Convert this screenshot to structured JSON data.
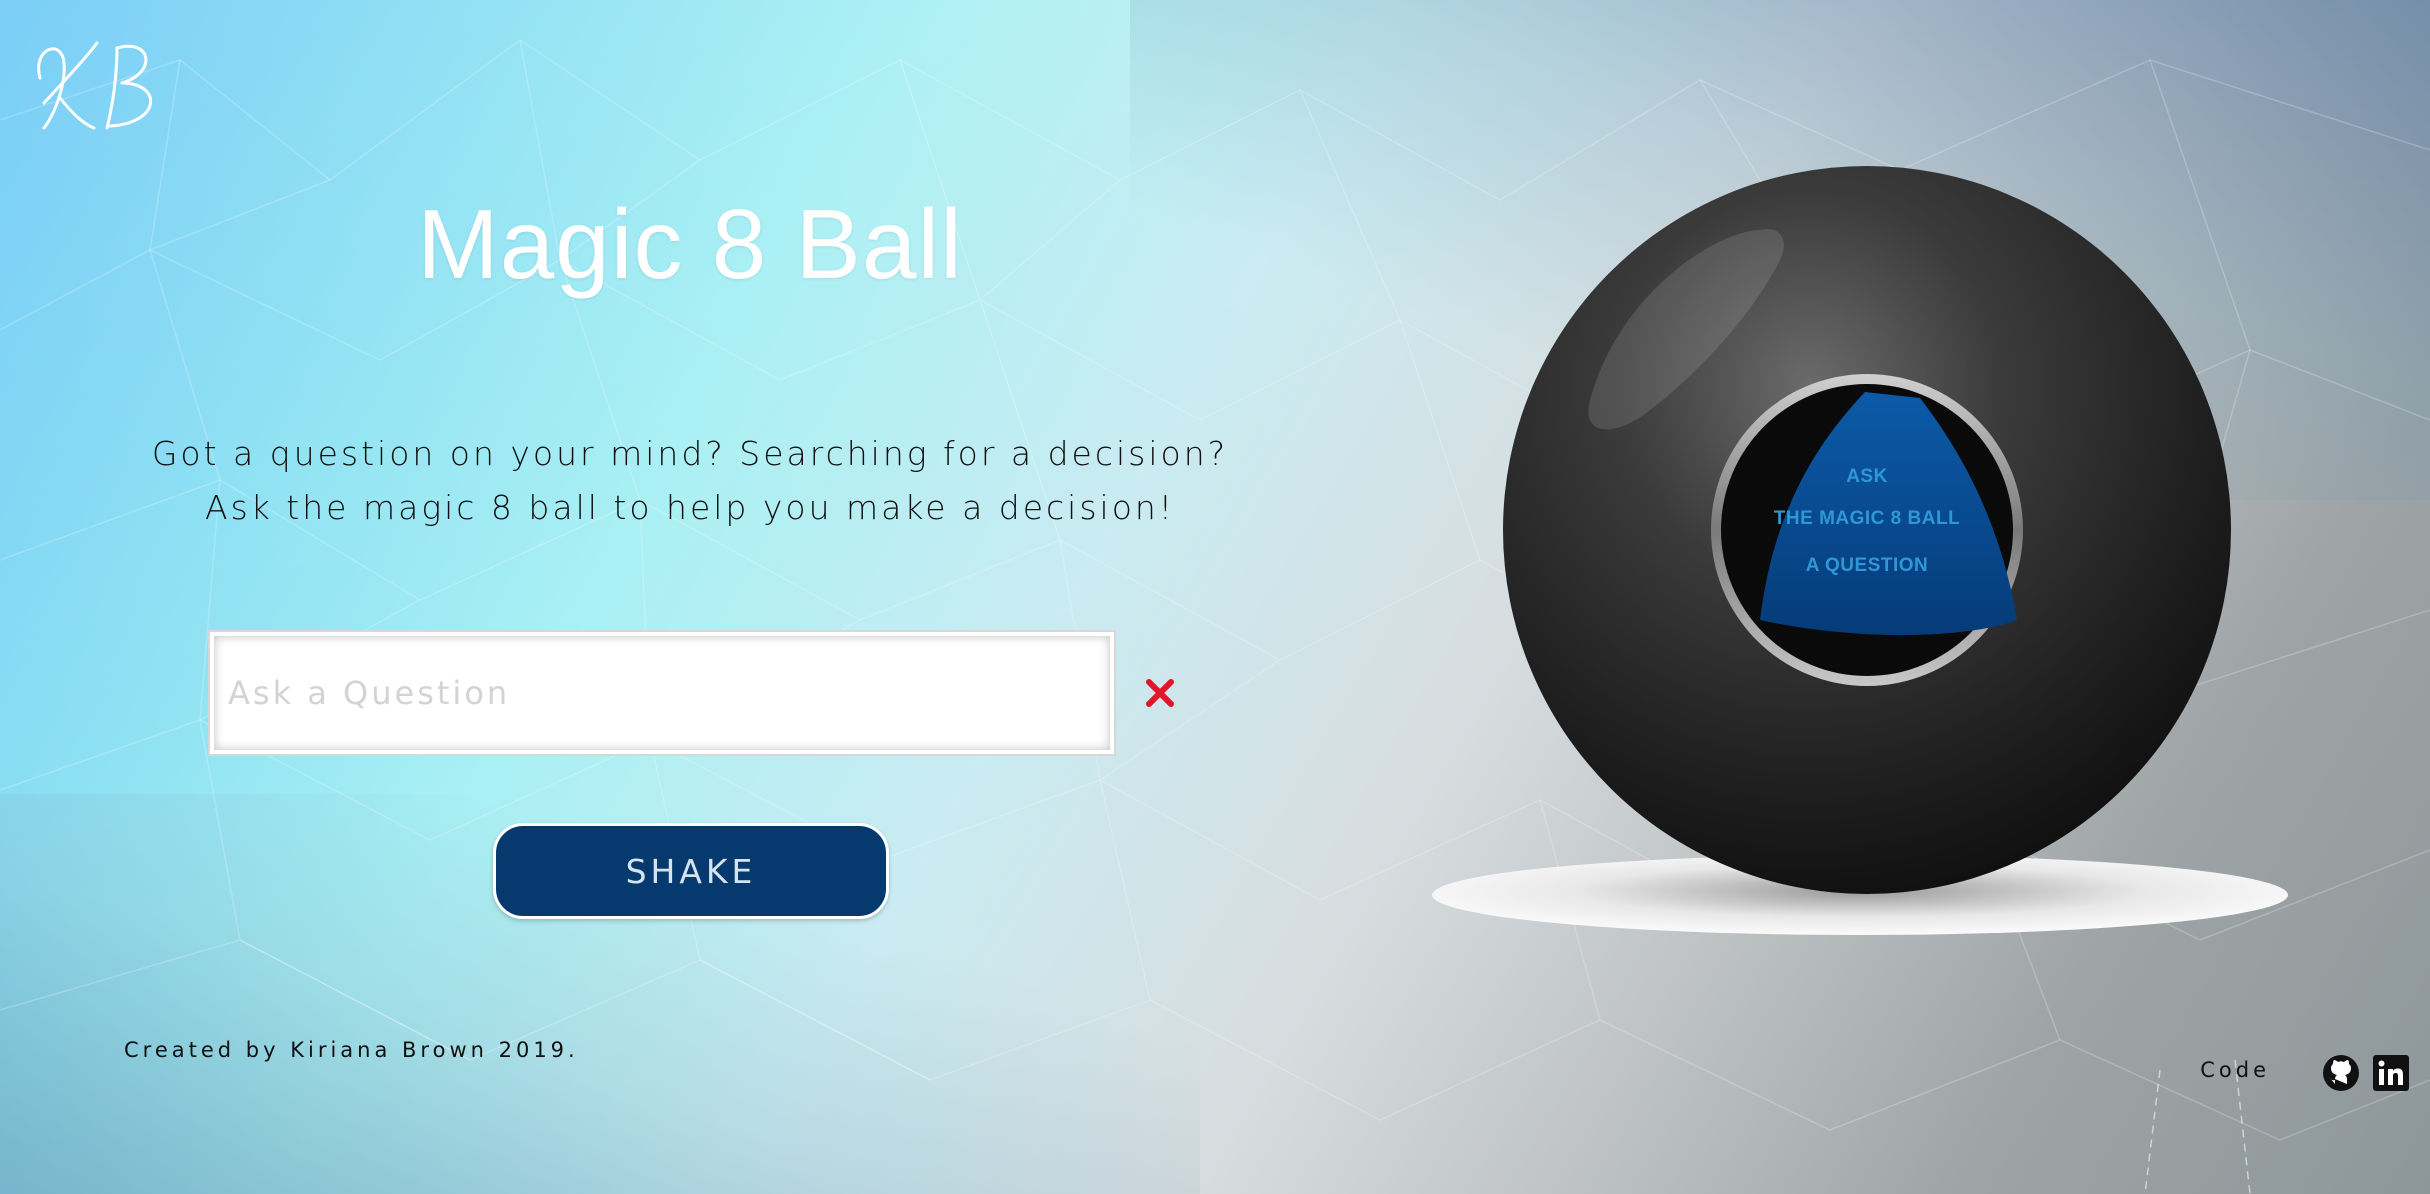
{
  "brand": {
    "logo_initials": "KB",
    "accent_color": "#063a6e"
  },
  "header": {
    "title": "Magic 8 Ball"
  },
  "intro": {
    "text": "Got a question on your mind? Searching for a decision? Ask the magic 8 ball to help you make a decision!"
  },
  "question": {
    "value": "",
    "placeholder": "Ask a Question",
    "clear_icon": "close-icon"
  },
  "actions": {
    "shake_label": "SHAKE"
  },
  "ball": {
    "line1": "ASK",
    "line2": "THE MAGIC 8 BALL",
    "line3": "A QUESTION"
  },
  "footer": {
    "credit": "Created by Kiriana Brown 2019.",
    "code_label": "Code",
    "icons": [
      "github-icon",
      "linkedin-icon"
    ]
  }
}
